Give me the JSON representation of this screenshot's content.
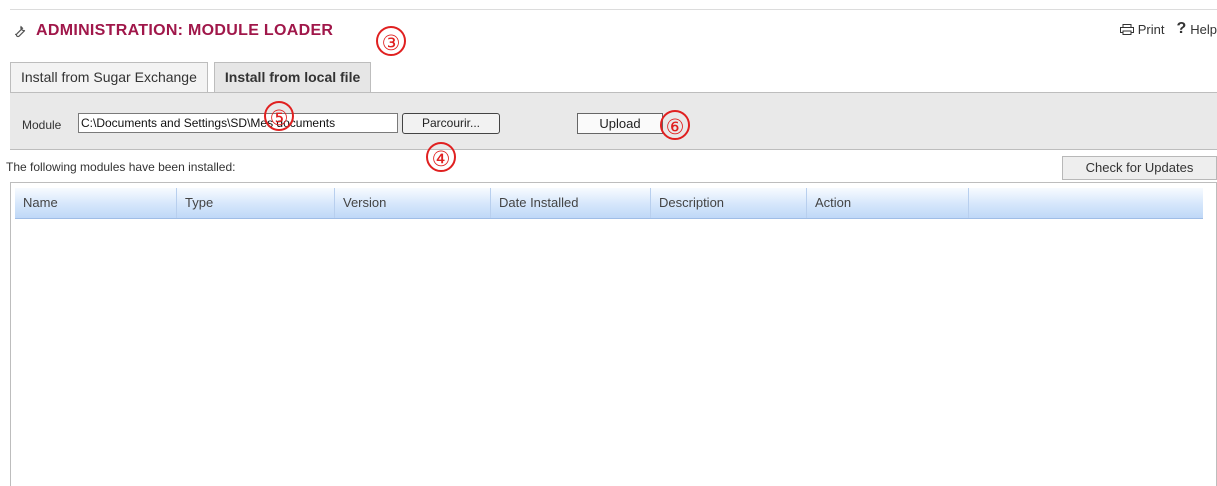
{
  "header": {
    "title": "ADMINISTRATION: MODULE LOADER",
    "print_label": "Print",
    "help_label": "Help",
    "accent_color": "#a0174a"
  },
  "tabs": [
    {
      "label": "Install from Sugar Exchange",
      "active": false
    },
    {
      "label": "Install from local file",
      "active": true
    }
  ],
  "upload_form": {
    "module_label": "Module",
    "file_value": "C:\\Documents and Settings\\SD\\Mes documents",
    "browse_label": "Parcourir...",
    "upload_label": "Upload"
  },
  "installed": {
    "message": "The following modules have been installed:",
    "check_updates_label": "Check for Updates",
    "columns": [
      "Name",
      "Type",
      "Version",
      "Date Installed",
      "Description",
      "Action"
    ],
    "rows": []
  },
  "annotations": [
    "③",
    "④",
    "⑤",
    "⑥"
  ]
}
